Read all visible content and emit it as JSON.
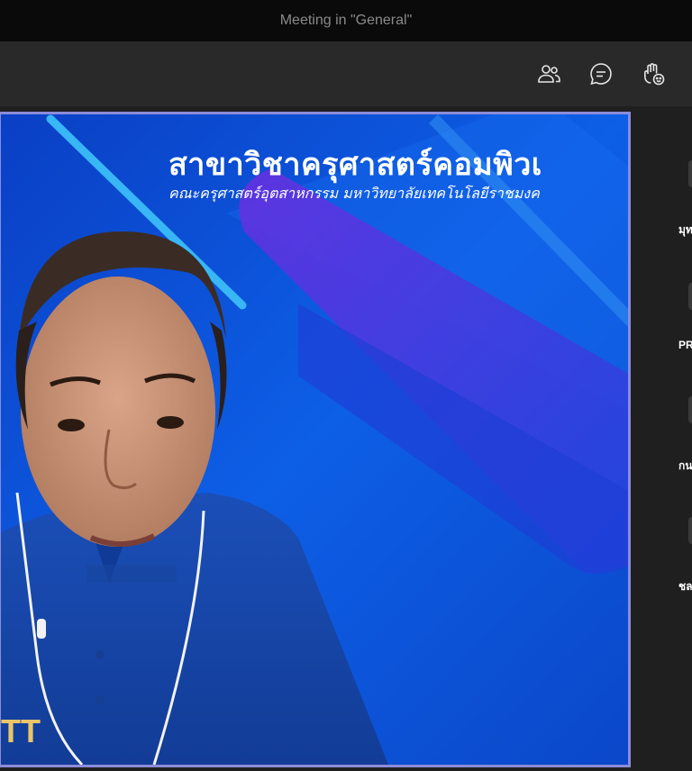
{
  "window": {
    "title": "Meeting in \"General\""
  },
  "toolbar": {
    "buttons": [
      {
        "name": "participants",
        "icon": "people-icon"
      },
      {
        "name": "chat",
        "icon": "chat-icon"
      },
      {
        "name": "reactions",
        "icon": "raise-hand-icon"
      }
    ]
  },
  "video": {
    "banner_title": "สาขาวิชาครุศาสตร์คอมพิวเ",
    "banner_subtitle": "คณะครุศาสตร์อุตสาหกรรม มหาวิทยาลัยเทคโนโลยีราชมงค",
    "shirt_logo": "TT"
  },
  "participants": [
    {
      "name": "มุท"
    },
    {
      "name": "PR"
    },
    {
      "name": "กน"
    },
    {
      "name": "ชล"
    }
  ],
  "colors": {
    "active_speaker_border": "#8b8cd9",
    "background_blue": "#0b4bd8",
    "title_bar": "#0a0a0a",
    "toolbar": "#292929"
  }
}
